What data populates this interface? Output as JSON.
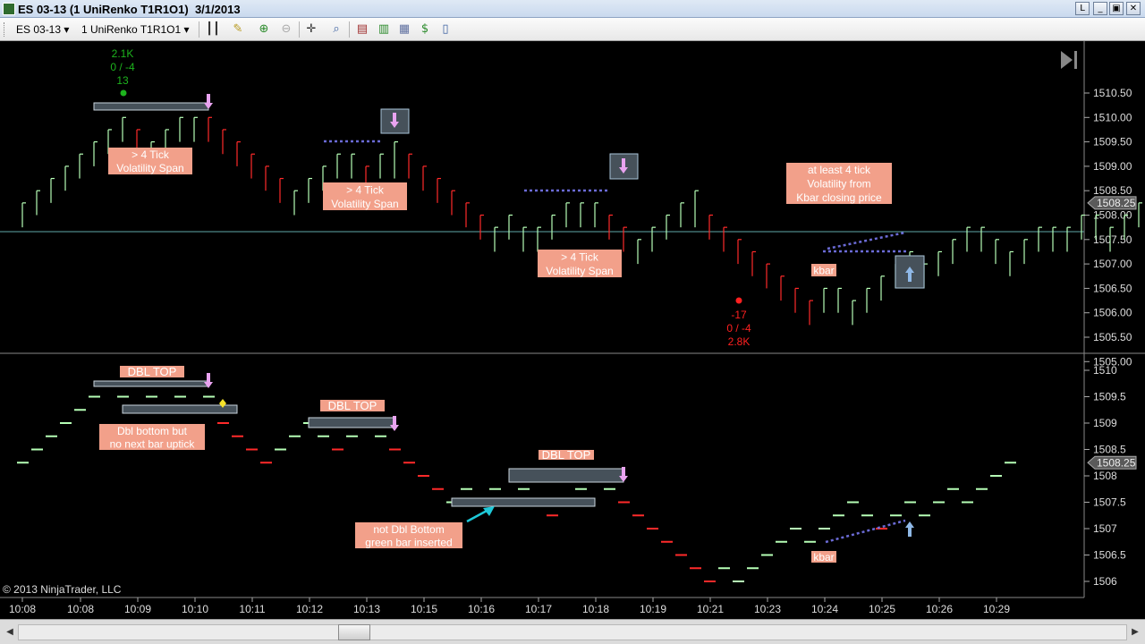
{
  "window": {
    "title": "ES 03-13 (1 UniRenko T1R1O1)  3/1/2013",
    "buttons": [
      "L",
      "_",
      "▣",
      "✕"
    ]
  },
  "toolbar": {
    "instrument": "ES 03-13",
    "period": "1 UniRenko T1R1O1"
  },
  "colors": {
    "up": "#b6ffb6",
    "down": "#ff2a2a",
    "annotation_fill": "#f2a08a",
    "box_fill": "#46515a",
    "marker": "#e9a3f0",
    "dotted": "#6b6bd6",
    "hline": "#5fa7a7"
  },
  "price_axis": {
    "upper": [
      "1510.50",
      "1510.00",
      "1509.50",
      "1509.00",
      "1508.50",
      "1508.00",
      "1507.50",
      "1507.00",
      "1506.50",
      "1506.00",
      "1505.50",
      "1505.00"
    ],
    "lower": [
      "1510",
      "1509.5",
      "1509",
      "1508.5",
      "1508",
      "1507.5",
      "1507",
      "1506.5",
      "1506"
    ],
    "current_upper": "1508.25",
    "current_lower": "1508.25"
  },
  "time_axis": [
    "10:08",
    "10:08",
    "10:09",
    "10:10",
    "10:11",
    "10:12",
    "10:13",
    "10:15",
    "10:16",
    "10:17",
    "10:18",
    "10:19",
    "10:21",
    "10:23",
    "10:24",
    "10:25",
    "10:26",
    "10:29"
  ],
  "copyright": "© 2013 NinjaTrader, LLC",
  "upper_annotations": {
    "swing_high": [
      "2.1K",
      "0 / -4",
      "13"
    ],
    "span1": [
      "> 4 Tick",
      "Volatility Span"
    ],
    "span2": [
      "> 4 Tick",
      "Volatility Span"
    ],
    "span3": [
      "> 4 Tick",
      "Volatility Span"
    ],
    "note": [
      "at least 4 tick",
      "Volatility from",
      "Kbar closing price"
    ],
    "kbar": "kbar",
    "swing_low": [
      "-17",
      "0 / -4",
      "2.8K"
    ]
  },
  "lower_annotations": {
    "dbl_top_1": "DBL TOP",
    "dbl_top_2": "DBL TOP",
    "dbl_top_3": "DBL TOP",
    "dbl_bottom": [
      "Dbl bottom but",
      "no next bar uptick"
    ],
    "not_dbl": [
      "not Dbl Bottom",
      "green bar inserted"
    ],
    "kbar": "kbar"
  },
  "upper_bars": [
    {
      "c": "g",
      "lo": 1507.75,
      "hi": 1508.25
    },
    {
      "c": "g",
      "lo": 1508.0,
      "hi": 1508.5
    },
    {
      "c": "g",
      "lo": 1508.25,
      "hi": 1508.75
    },
    {
      "c": "g",
      "lo": 1508.5,
      "hi": 1509.0
    },
    {
      "c": "g",
      "lo": 1508.75,
      "hi": 1509.25
    },
    {
      "c": "g",
      "lo": 1509.0,
      "hi": 1509.5
    },
    {
      "c": "g",
      "lo": 1509.25,
      "hi": 1509.75
    },
    {
      "c": "g",
      "lo": 1509.5,
      "hi": 1510.0
    },
    {
      "c": "r",
      "lo": 1509.25,
      "hi": 1509.75
    },
    {
      "c": "g",
      "lo": 1509.0,
      "hi": 1509.5
    },
    {
      "c": "g",
      "lo": 1509.25,
      "hi": 1509.75
    },
    {
      "c": "g",
      "lo": 1509.5,
      "hi": 1510.0
    },
    {
      "c": "g",
      "lo": 1509.5,
      "hi": 1510.0
    },
    {
      "c": "r",
      "lo": 1509.5,
      "hi": 1510.0
    },
    {
      "c": "r",
      "lo": 1509.25,
      "hi": 1509.75
    },
    {
      "c": "r",
      "lo": 1509.0,
      "hi": 1509.5
    },
    {
      "c": "r",
      "lo": 1508.75,
      "hi": 1509.25
    },
    {
      "c": "r",
      "lo": 1508.5,
      "hi": 1509.0
    },
    {
      "c": "r",
      "lo": 1508.25,
      "hi": 1508.75
    },
    {
      "c": "g",
      "lo": 1508.0,
      "hi": 1508.5
    },
    {
      "c": "g",
      "lo": 1508.25,
      "hi": 1508.75
    },
    {
      "c": "g",
      "lo": 1508.5,
      "hi": 1509.0
    },
    {
      "c": "g",
      "lo": 1508.75,
      "hi": 1509.25
    },
    {
      "c": "g",
      "lo": 1508.75,
      "hi": 1509.25
    },
    {
      "c": "r",
      "lo": 1508.5,
      "hi": 1509.0
    },
    {
      "c": "g",
      "lo": 1508.75,
      "hi": 1509.25
    },
    {
      "c": "g",
      "lo": 1508.75,
      "hi": 1509.5
    },
    {
      "c": "r",
      "lo": 1508.75,
      "hi": 1509.25
    },
    {
      "c": "r",
      "lo": 1508.5,
      "hi": 1509.0
    },
    {
      "c": "r",
      "lo": 1508.25,
      "hi": 1508.75
    },
    {
      "c": "r",
      "lo": 1508.0,
      "hi": 1508.5
    },
    {
      "c": "r",
      "lo": 1507.75,
      "hi": 1508.25
    },
    {
      "c": "r",
      "lo": 1507.5,
      "hi": 1508.0
    },
    {
      "c": "g",
      "lo": 1507.25,
      "hi": 1507.75
    },
    {
      "c": "g",
      "lo": 1507.5,
      "hi": 1508.0
    },
    {
      "c": "g",
      "lo": 1507.25,
      "hi": 1507.75
    },
    {
      "c": "g",
      "lo": 1507.25,
      "hi": 1507.75
    },
    {
      "c": "g",
      "lo": 1507.5,
      "hi": 1508.0
    },
    {
      "c": "g",
      "lo": 1507.75,
      "hi": 1508.25
    },
    {
      "c": "g",
      "lo": 1507.75,
      "hi": 1508.25
    },
    {
      "c": "g",
      "lo": 1507.75,
      "hi": 1508.25
    },
    {
      "c": "r",
      "lo": 1507.5,
      "hi": 1508.0
    },
    {
      "c": "r",
      "lo": 1507.25,
      "hi": 1507.75
    },
    {
      "c": "g",
      "lo": 1507.0,
      "hi": 1507.5
    },
    {
      "c": "g",
      "lo": 1507.25,
      "hi": 1507.75
    },
    {
      "c": "g",
      "lo": 1507.5,
      "hi": 1508.0
    },
    {
      "c": "g",
      "lo": 1507.75,
      "hi": 1508.25
    },
    {
      "c": "g",
      "lo": 1507.75,
      "hi": 1508.5
    },
    {
      "c": "r",
      "lo": 1507.5,
      "hi": 1508.0
    },
    {
      "c": "r",
      "lo": 1507.25,
      "hi": 1507.75
    },
    {
      "c": "r",
      "lo": 1507.0,
      "hi": 1507.5
    },
    {
      "c": "r",
      "lo": 1506.75,
      "hi": 1507.25
    },
    {
      "c": "r",
      "lo": 1506.5,
      "hi": 1507.0
    },
    {
      "c": "r",
      "lo": 1506.25,
      "hi": 1506.75
    },
    {
      "c": "r",
      "lo": 1506.0,
      "hi": 1506.5
    },
    {
      "c": "r",
      "lo": 1505.75,
      "hi": 1506.25
    },
    {
      "c": "g",
      "lo": 1506.0,
      "hi": 1506.5
    },
    {
      "c": "g",
      "lo": 1506.0,
      "hi": 1506.5
    },
    {
      "c": "g",
      "lo": 1505.75,
      "hi": 1506.25
    },
    {
      "c": "g",
      "lo": 1506.0,
      "hi": 1506.5
    },
    {
      "c": "g",
      "lo": 1506.25,
      "hi": 1506.75
    },
    {
      "c": "g",
      "lo": 1506.5,
      "hi": 1507.0
    },
    {
      "c": "g",
      "lo": 1506.75,
      "hi": 1507.25
    },
    {
      "c": "g",
      "lo": 1506.5,
      "hi": 1507.0
    },
    {
      "c": "g",
      "lo": 1506.75,
      "hi": 1507.25
    },
    {
      "c": "g",
      "lo": 1507.0,
      "hi": 1507.5
    },
    {
      "c": "g",
      "lo": 1507.25,
      "hi": 1507.75
    },
    {
      "c": "g",
      "lo": 1507.25,
      "hi": 1507.75
    },
    {
      "c": "g",
      "lo": 1507.0,
      "hi": 1507.5
    },
    {
      "c": "g",
      "lo": 1506.75,
      "hi": 1507.25
    },
    {
      "c": "g",
      "lo": 1507.0,
      "hi": 1507.5
    },
    {
      "c": "g",
      "lo": 1507.25,
      "hi": 1507.75
    },
    {
      "c": "g",
      "lo": 1507.25,
      "hi": 1507.75
    },
    {
      "c": "g",
      "lo": 1507.25,
      "hi": 1507.75
    },
    {
      "c": "g",
      "lo": 1507.5,
      "hi": 1508.0
    },
    {
      "c": "g",
      "lo": 1507.5,
      "hi": 1508.0
    },
    {
      "c": "g",
      "lo": 1507.25,
      "hi": 1507.75
    },
    {
      "c": "g",
      "lo": 1507.5,
      "hi": 1508.0
    },
    {
      "c": "g",
      "lo": 1507.75,
      "hi": 1508.25
    }
  ],
  "lower_dashes": [
    {
      "c": "g",
      "p": 1508.25
    },
    {
      "c": "g",
      "p": 1508.5
    },
    {
      "c": "g",
      "p": 1508.75
    },
    {
      "c": "g",
      "p": 1509.0
    },
    {
      "c": "g",
      "p": 1509.25
    },
    {
      "c": "g",
      "p": 1509.5
    },
    {
      "c": "g",
      "p": 1509.75
    },
    {
      "c": "g",
      "p": 1509.5
    },
    {
      "c": "r",
      "p": 1509.25
    },
    {
      "c": "g",
      "p": 1509.5
    },
    {
      "c": "g",
      "p": 1509.75
    },
    {
      "c": "g",
      "p": 1509.5
    },
    {
      "c": "g",
      "p": 1509.75
    },
    {
      "c": "g",
      "p": 1509.5
    },
    {
      "c": "r",
      "p": 1509.0
    },
    {
      "c": "r",
      "p": 1508.75
    },
    {
      "c": "r",
      "p": 1508.5
    },
    {
      "c": "r",
      "p": 1508.25
    },
    {
      "c": "g",
      "p": 1508.5
    },
    {
      "c": "g",
      "p": 1508.75
    },
    {
      "c": "g",
      "p": 1509.0
    },
    {
      "c": "g",
      "p": 1508.75
    },
    {
      "c": "r",
      "p": 1508.5
    },
    {
      "c": "g",
      "p": 1508.75
    },
    {
      "c": "g",
      "p": 1509.0
    },
    {
      "c": "g",
      "p": 1508.75
    },
    {
      "c": "r",
      "p": 1508.5
    },
    {
      "c": "r",
      "p": 1508.25
    },
    {
      "c": "r",
      "p": 1508.0
    },
    {
      "c": "r",
      "p": 1507.75
    },
    {
      "c": "g",
      "p": 1507.5
    },
    {
      "c": "g",
      "p": 1507.75
    },
    {
      "c": "g",
      "p": 1507.5
    },
    {
      "c": "g",
      "p": 1507.75
    },
    {
      "c": "r",
      "p": 1507.5
    },
    {
      "c": "g",
      "p": 1507.75
    },
    {
      "c": "g",
      "p": 1507.5
    },
    {
      "c": "r",
      "p": 1507.25
    },
    {
      "c": "g",
      "p": 1507.5
    },
    {
      "c": "g",
      "p": 1507.75
    },
    {
      "c": "g",
      "p": 1508.0
    },
    {
      "c": "g",
      "p": 1507.75
    },
    {
      "c": "r",
      "p": 1507.5
    },
    {
      "c": "r",
      "p": 1507.25
    },
    {
      "c": "r",
      "p": 1507.0
    },
    {
      "c": "r",
      "p": 1506.75
    },
    {
      "c": "r",
      "p": 1506.5
    },
    {
      "c": "r",
      "p": 1506.25
    },
    {
      "c": "r",
      "p": 1506.0
    },
    {
      "c": "g",
      "p": 1506.25
    },
    {
      "c": "g",
      "p": 1506.0
    },
    {
      "c": "g",
      "p": 1506.25
    },
    {
      "c": "g",
      "p": 1506.5
    },
    {
      "c": "g",
      "p": 1506.75
    },
    {
      "c": "g",
      "p": 1507.0
    },
    {
      "c": "g",
      "p": 1506.75
    },
    {
      "c": "g",
      "p": 1507.0
    },
    {
      "c": "g",
      "p": 1507.25
    },
    {
      "c": "g",
      "p": 1507.5
    },
    {
      "c": "g",
      "p": 1507.25
    },
    {
      "c": "r",
      "p": 1507.0
    },
    {
      "c": "g",
      "p": 1507.25
    },
    {
      "c": "g",
      "p": 1507.5
    },
    {
      "c": "g",
      "p": 1507.25
    },
    {
      "c": "g",
      "p": 1507.5
    },
    {
      "c": "g",
      "p": 1507.75
    },
    {
      "c": "g",
      "p": 1507.5
    },
    {
      "c": "g",
      "p": 1507.75
    },
    {
      "c": "g",
      "p": 1508.0
    },
    {
      "c": "g",
      "p": 1508.25
    }
  ]
}
